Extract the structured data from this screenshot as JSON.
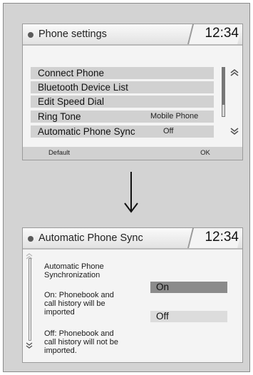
{
  "screen1": {
    "title": "Phone settings",
    "clock": "12:34",
    "menu": [
      {
        "label": "Connect Phone",
        "value": ""
      },
      {
        "label": "Bluetooth Device List",
        "value": ""
      },
      {
        "label": "Edit Speed Dial",
        "value": ""
      },
      {
        "label": "Ring Tone",
        "value": "Mobile Phone"
      },
      {
        "label": "Automatic Phone Sync",
        "value": "Off"
      }
    ],
    "softkeys": {
      "left": "Default",
      "right": "OK"
    }
  },
  "screen2": {
    "title": "Automatic Phone Sync",
    "clock": "12:34",
    "description": [
      "Automatic Phone",
      "Synchronization",
      "On: Phonebook and",
      "call history will be",
      "imported",
      "Off: Phonebook and",
      "call history will not be",
      "imported."
    ],
    "options": {
      "on": "On",
      "off": "Off"
    },
    "selected": "On"
  },
  "icons": {
    "scroll_up": "double-chevron-up-icon",
    "scroll_down": "double-chevron-down-icon",
    "transition": "arrow-down-icon"
  }
}
